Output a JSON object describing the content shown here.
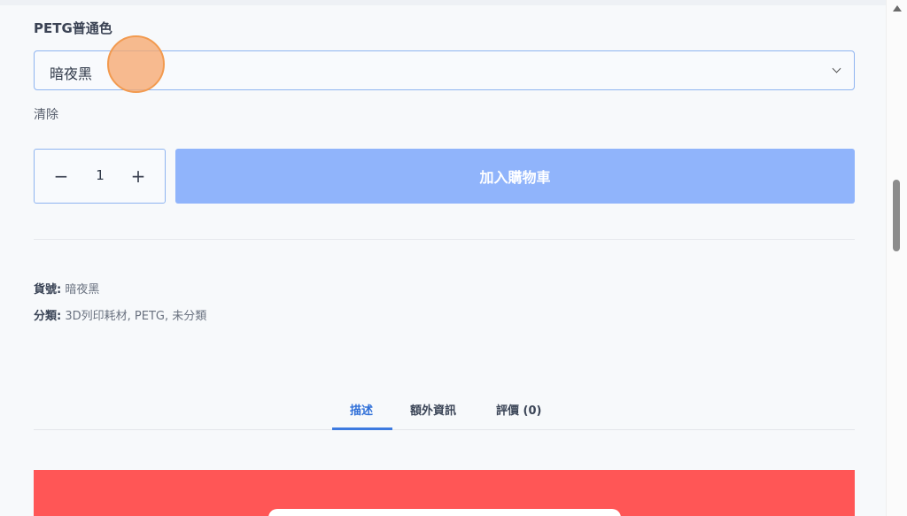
{
  "variant": {
    "label": "PETG普通色",
    "selected": "暗夜黑",
    "clear_label": "清除"
  },
  "quantity": {
    "minus": "−",
    "value": "1",
    "plus": "+"
  },
  "add_to_cart": {
    "label": "加入購物車",
    "color": "#90b4fb"
  },
  "meta": {
    "sku_label": "貨號:",
    "sku_value": "暗夜黑",
    "category_label": "分類:",
    "category_value": "3D列印耗材, PETG, 未分類"
  },
  "tabs": [
    {
      "label": "描述",
      "active": true
    },
    {
      "label": "額外資訊",
      "active": false
    },
    {
      "label": "評價 (0)",
      "active": false
    }
  ],
  "colors": {
    "accent": "#3d7ae0",
    "banner": "#ff5656",
    "click_indicator": "#f6a870"
  }
}
